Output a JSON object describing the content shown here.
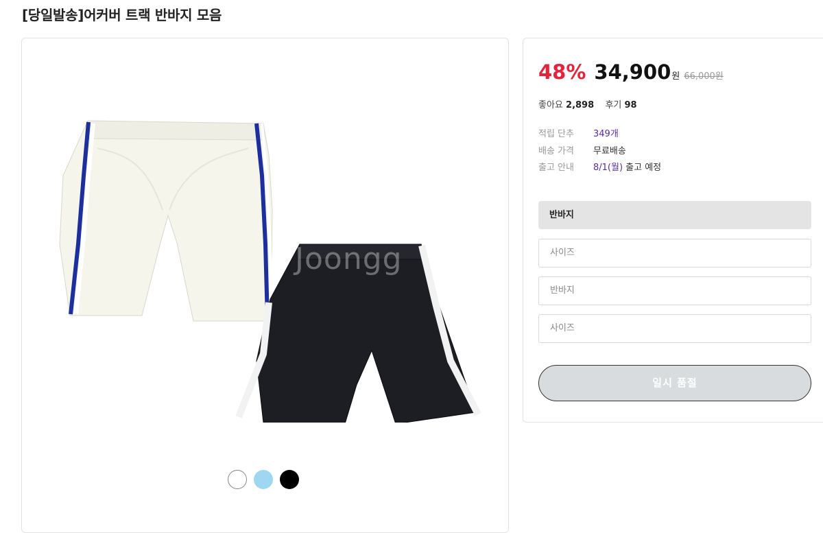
{
  "product": {
    "title": "[당일발송]어커버 트랙 반바지 모음",
    "watermark": "Joongg"
  },
  "swatches": [
    {
      "name": "white",
      "color": "#ffffff"
    },
    {
      "name": "sky-blue",
      "color": "#9fd7f3"
    },
    {
      "name": "black",
      "color": "#000000"
    }
  ],
  "pricing": {
    "discount": "48%",
    "price": "34,900",
    "currency": "원",
    "original_price": "66,000원"
  },
  "stats": {
    "likes_label": "좋아요",
    "likes_value": "2,898",
    "reviews_label": "후기",
    "reviews_value": "98"
  },
  "meta": {
    "points_label": "적립 단추",
    "points_value": "349개",
    "shipping_label": "배송 가격",
    "shipping_value": "무료배송",
    "release_label": "출고 안내",
    "release_date": "8/1(월)",
    "release_suffix": " 출고 예정"
  },
  "options": {
    "header": "반바지",
    "select_1": "사이즈",
    "select_2": "반바지",
    "select_3": "사이즈"
  },
  "buttons": {
    "soldout": "일시 품절"
  },
  "colors": {
    "discount": "#e4243b",
    "accent_purple": "#5a2d9c",
    "soldout_bg": "#d9dcdf"
  }
}
